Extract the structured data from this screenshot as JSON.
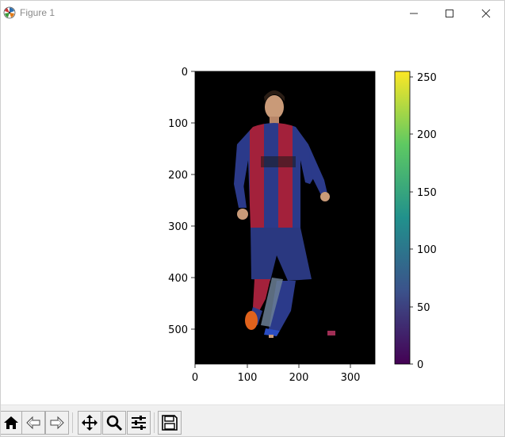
{
  "window": {
    "title": "Figure 1",
    "icons": {
      "app": "matplotlib-logo-icon",
      "minimize": "minimize-icon",
      "maximize": "maximize-icon",
      "close": "close-icon"
    }
  },
  "figure": {
    "image_description_role": "soccer-player-photo",
    "x_ticks": [
      "0",
      "100",
      "200",
      "300"
    ],
    "y_ticks": [
      "0",
      "100",
      "200",
      "300",
      "400",
      "500"
    ],
    "colorbar": {
      "colormap": "viridis",
      "ticks": [
        "0",
        "50",
        "100",
        "150",
        "200",
        "250"
      ],
      "colors": [
        "#440154",
        "#3b528b",
        "#21918c",
        "#5ec962",
        "#fde725"
      ]
    },
    "image_background": "#000000",
    "jersey_colors": [
      "#2b3a8a",
      "#a3213b"
    ]
  },
  "toolbar": {
    "buttons": [
      {
        "name": "home-button",
        "icon": "home-icon"
      },
      {
        "name": "back-button",
        "icon": "back-arrow-icon"
      },
      {
        "name": "forward-button",
        "icon": "forward-arrow-icon"
      },
      {
        "name": "pan-button",
        "icon": "move-icon"
      },
      {
        "name": "zoom-button",
        "icon": "zoom-icon"
      },
      {
        "name": "subplots-button",
        "icon": "sliders-icon"
      },
      {
        "name": "save-button",
        "icon": "save-icon"
      }
    ]
  }
}
